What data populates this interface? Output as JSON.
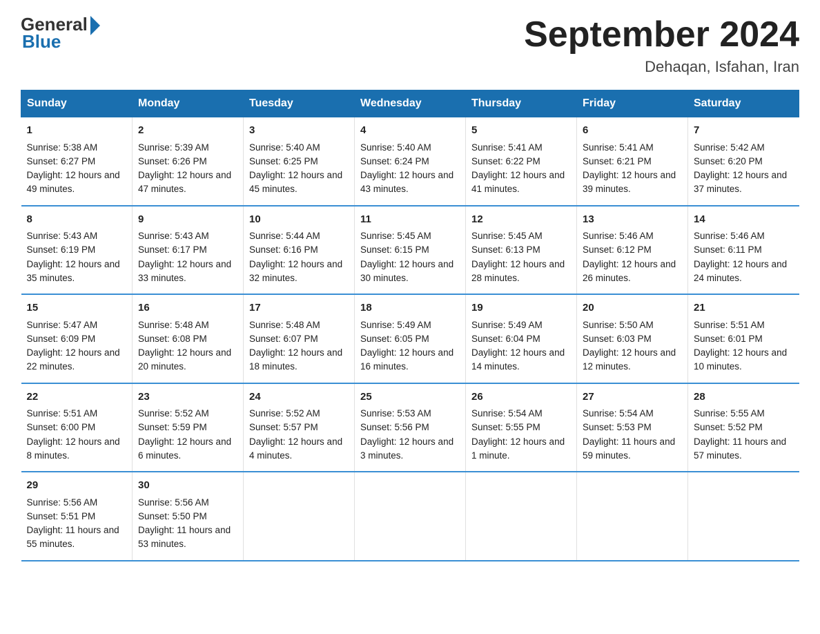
{
  "logo": {
    "general": "General",
    "blue": "Blue"
  },
  "title": "September 2024",
  "subtitle": "Dehaqan, Isfahan, Iran",
  "days_header": [
    "Sunday",
    "Monday",
    "Tuesday",
    "Wednesday",
    "Thursday",
    "Friday",
    "Saturday"
  ],
  "weeks": [
    [
      {
        "day": "1",
        "sunrise": "5:38 AM",
        "sunset": "6:27 PM",
        "daylight": "12 hours and 49 minutes."
      },
      {
        "day": "2",
        "sunrise": "5:39 AM",
        "sunset": "6:26 PM",
        "daylight": "12 hours and 47 minutes."
      },
      {
        "day": "3",
        "sunrise": "5:40 AM",
        "sunset": "6:25 PM",
        "daylight": "12 hours and 45 minutes."
      },
      {
        "day": "4",
        "sunrise": "5:40 AM",
        "sunset": "6:24 PM",
        "daylight": "12 hours and 43 minutes."
      },
      {
        "day": "5",
        "sunrise": "5:41 AM",
        "sunset": "6:22 PM",
        "daylight": "12 hours and 41 minutes."
      },
      {
        "day": "6",
        "sunrise": "5:41 AM",
        "sunset": "6:21 PM",
        "daylight": "12 hours and 39 minutes."
      },
      {
        "day": "7",
        "sunrise": "5:42 AM",
        "sunset": "6:20 PM",
        "daylight": "12 hours and 37 minutes."
      }
    ],
    [
      {
        "day": "8",
        "sunrise": "5:43 AM",
        "sunset": "6:19 PM",
        "daylight": "12 hours and 35 minutes."
      },
      {
        "day": "9",
        "sunrise": "5:43 AM",
        "sunset": "6:17 PM",
        "daylight": "12 hours and 33 minutes."
      },
      {
        "day": "10",
        "sunrise": "5:44 AM",
        "sunset": "6:16 PM",
        "daylight": "12 hours and 32 minutes."
      },
      {
        "day": "11",
        "sunrise": "5:45 AM",
        "sunset": "6:15 PM",
        "daylight": "12 hours and 30 minutes."
      },
      {
        "day": "12",
        "sunrise": "5:45 AM",
        "sunset": "6:13 PM",
        "daylight": "12 hours and 28 minutes."
      },
      {
        "day": "13",
        "sunrise": "5:46 AM",
        "sunset": "6:12 PM",
        "daylight": "12 hours and 26 minutes."
      },
      {
        "day": "14",
        "sunrise": "5:46 AM",
        "sunset": "6:11 PM",
        "daylight": "12 hours and 24 minutes."
      }
    ],
    [
      {
        "day": "15",
        "sunrise": "5:47 AM",
        "sunset": "6:09 PM",
        "daylight": "12 hours and 22 minutes."
      },
      {
        "day": "16",
        "sunrise": "5:48 AM",
        "sunset": "6:08 PM",
        "daylight": "12 hours and 20 minutes."
      },
      {
        "day": "17",
        "sunrise": "5:48 AM",
        "sunset": "6:07 PM",
        "daylight": "12 hours and 18 minutes."
      },
      {
        "day": "18",
        "sunrise": "5:49 AM",
        "sunset": "6:05 PM",
        "daylight": "12 hours and 16 minutes."
      },
      {
        "day": "19",
        "sunrise": "5:49 AM",
        "sunset": "6:04 PM",
        "daylight": "12 hours and 14 minutes."
      },
      {
        "day": "20",
        "sunrise": "5:50 AM",
        "sunset": "6:03 PM",
        "daylight": "12 hours and 12 minutes."
      },
      {
        "day": "21",
        "sunrise": "5:51 AM",
        "sunset": "6:01 PM",
        "daylight": "12 hours and 10 minutes."
      }
    ],
    [
      {
        "day": "22",
        "sunrise": "5:51 AM",
        "sunset": "6:00 PM",
        "daylight": "12 hours and 8 minutes."
      },
      {
        "day": "23",
        "sunrise": "5:52 AM",
        "sunset": "5:59 PM",
        "daylight": "12 hours and 6 minutes."
      },
      {
        "day": "24",
        "sunrise": "5:52 AM",
        "sunset": "5:57 PM",
        "daylight": "12 hours and 4 minutes."
      },
      {
        "day": "25",
        "sunrise": "5:53 AM",
        "sunset": "5:56 PM",
        "daylight": "12 hours and 3 minutes."
      },
      {
        "day": "26",
        "sunrise": "5:54 AM",
        "sunset": "5:55 PM",
        "daylight": "12 hours and 1 minute."
      },
      {
        "day": "27",
        "sunrise": "5:54 AM",
        "sunset": "5:53 PM",
        "daylight": "11 hours and 59 minutes."
      },
      {
        "day": "28",
        "sunrise": "5:55 AM",
        "sunset": "5:52 PM",
        "daylight": "11 hours and 57 minutes."
      }
    ],
    [
      {
        "day": "29",
        "sunrise": "5:56 AM",
        "sunset": "5:51 PM",
        "daylight": "11 hours and 55 minutes."
      },
      {
        "day": "30",
        "sunrise": "5:56 AM",
        "sunset": "5:50 PM",
        "daylight": "11 hours and 53 minutes."
      },
      null,
      null,
      null,
      null,
      null
    ]
  ]
}
